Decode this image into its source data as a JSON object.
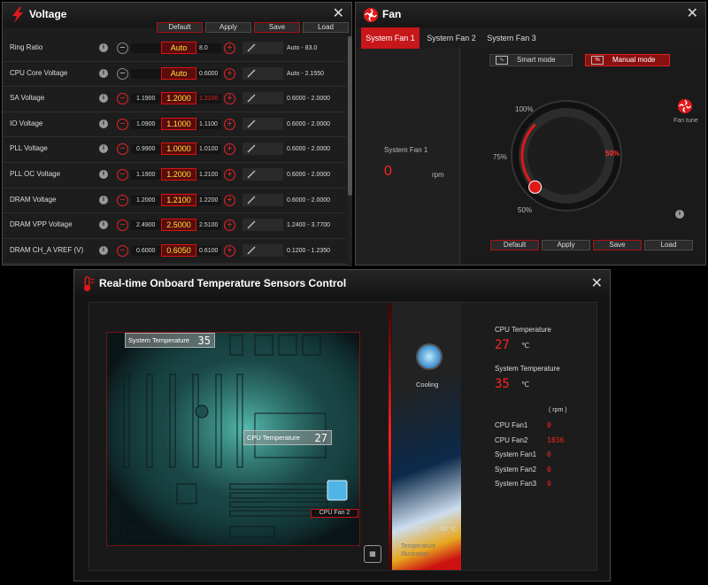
{
  "voltage": {
    "title": "Voltage",
    "buttons": {
      "default": "Default",
      "apply": "Apply",
      "save": "Save",
      "load": "Load"
    },
    "rows": [
      {
        "label": "Ring Ratio",
        "low": "",
        "current": "Auto",
        "high": "8.0",
        "range": "Auto - 83.0"
      },
      {
        "label": "CPU Core Voltage",
        "low": "",
        "current": "Auto",
        "high": "0.6000",
        "range": "Auto - 2.1550"
      },
      {
        "label": "SA Voltage",
        "low": "1.1900",
        "current": "1.2000",
        "high": "1.2100",
        "range": "0.6000 - 2.0000"
      },
      {
        "label": "IO Voltage",
        "low": "1.0900",
        "current": "1.1000",
        "high": "1.1100",
        "range": "0.6000 - 2.0000"
      },
      {
        "label": "PLL Voltage",
        "low": "0.9900",
        "current": "1.0000",
        "high": "1.0100",
        "range": "0.6000 - 2.0000"
      },
      {
        "label": "PLL OC Voltage",
        "low": "1.1900",
        "current": "1.2000",
        "high": "1.2100",
        "range": "0.6000 - 2.0000"
      },
      {
        "label": "DRAM Voltage",
        "low": "1.2000",
        "current": "1.2100",
        "high": "1.2200",
        "range": "0.6000 - 2.0000"
      },
      {
        "label": "DRAM VPP Voltage",
        "low": "2.4900",
        "current": "2.5000",
        "high": "2.5100",
        "range": "1.2400 - 3.7700"
      },
      {
        "label": "DRAM CH_A VREF (V)",
        "low": "0.6000",
        "current": "0.6050",
        "high": "0.6100",
        "range": "0.1200 - 1.2350"
      }
    ]
  },
  "fan": {
    "title": "Fan",
    "tabs": [
      "System Fan 1",
      "System Fan 2",
      "System Fan 3"
    ],
    "active_tab": 0,
    "left": {
      "name": "System Fan 1",
      "value": "0",
      "unit": "rpm"
    },
    "modes": {
      "smart": "Smart mode",
      "manual": "Manual mode"
    },
    "dial": {
      "top": "100%",
      "mid": "75%",
      "bottom": "50%",
      "value": "50%",
      "fraction": 0.5
    },
    "fan_tune": "Fan tune",
    "buttons": {
      "default": "Default",
      "apply": "Apply",
      "save": "Save",
      "load": "Load"
    }
  },
  "temp": {
    "title": "Real-time Onboard Temperature Sensors Control",
    "board_labels": {
      "system": "System Temperature",
      "system_val": "35",
      "cpu": "CPU Temperature",
      "cpu_val": "27",
      "cpu_fan2": "CPU Fan 2"
    },
    "cooling": "Cooling",
    "illustration": {
      "low": "30 ℃",
      "high": "60 ℃",
      "caption1": "Temperature",
      "caption2": "Illustration"
    },
    "sensors": {
      "cpu_label": "CPU Temperature",
      "cpu_value": "27",
      "cpu_unit": "℃",
      "sys_label": "System Temperature",
      "sys_value": "35",
      "sys_unit": "℃",
      "rpm_header": "( rpm )",
      "fans": [
        {
          "label": "CPU Fan1",
          "value": "0"
        },
        {
          "label": "CPU Fan2",
          "value": "1836"
        },
        {
          "label": "System Fan1",
          "value": "0"
        },
        {
          "label": "System Fan2",
          "value": "0"
        },
        {
          "label": "System Fan3",
          "value": "0"
        }
      ]
    },
    "colors": {
      "accent": "#e01818",
      "panel": "#1c1c1c"
    }
  }
}
